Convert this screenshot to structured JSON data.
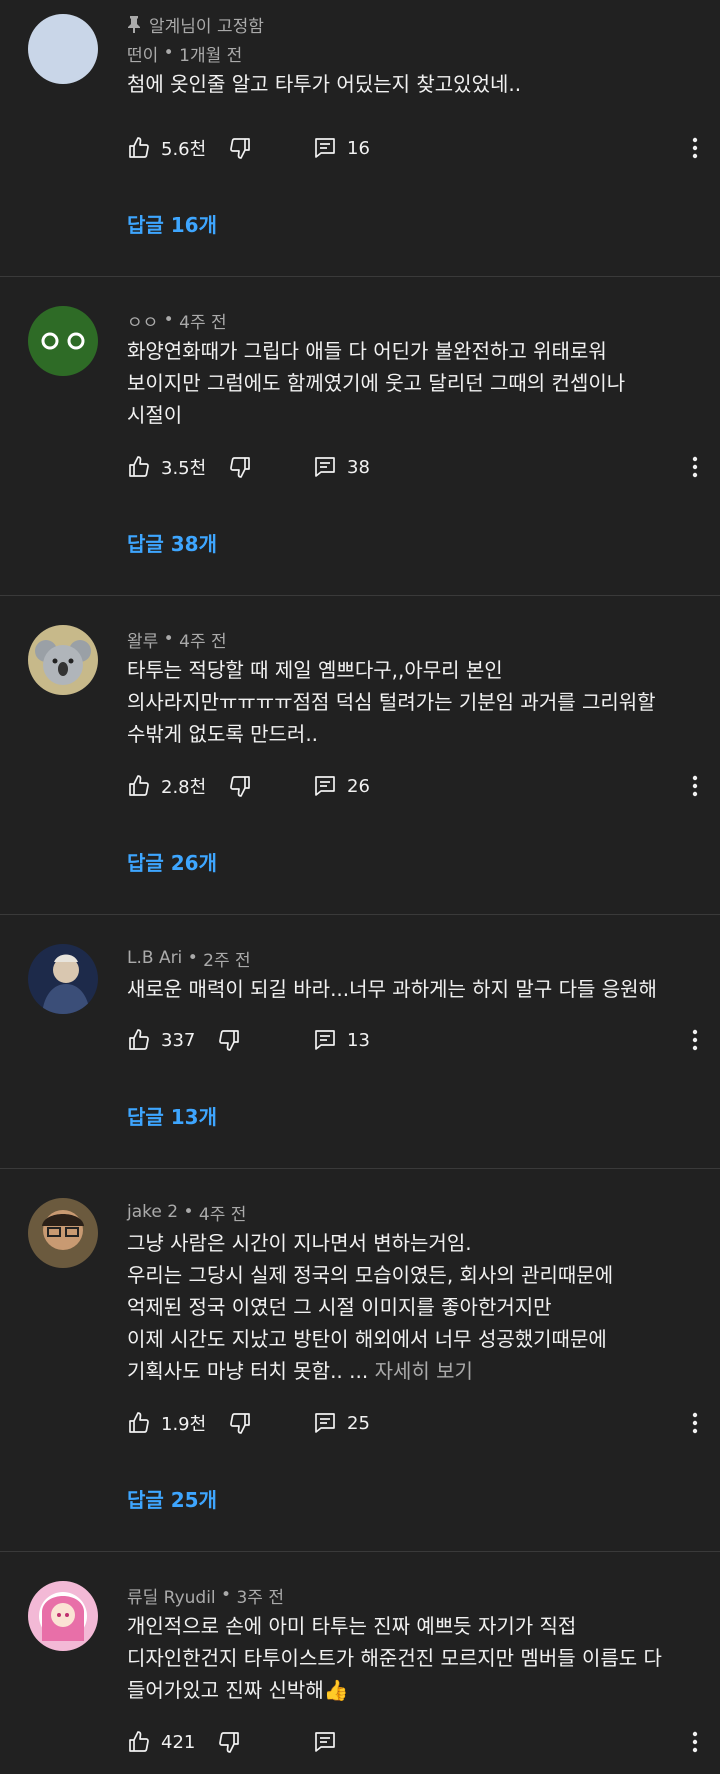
{
  "comments": [
    {
      "pinned_label": "알계님이 고정함",
      "author": "떤이",
      "time": "1개월 전",
      "lines": [
        "첨에 옷인줄 알고 타투가 어딨는지 찾고있었네.."
      ],
      "likes": "5.6천",
      "reply_count": "16",
      "replies_label": "답글 16개",
      "avatar_color": "#c9d6e8"
    },
    {
      "author": "ㅇㅇ",
      "time": "4주 전",
      "lines": [
        "화양연화때가 그립다 애들 다 어딘가 불완전하고 위태로워",
        "보이지만 그럼에도 함께였기에 웃고 달리던 그때의 컨셉이나",
        "시절이"
      ],
      "likes": "3.5천",
      "reply_count": "38",
      "replies_label": "답글 38개",
      "avatar_color": "#2e6b26"
    },
    {
      "author": "왈루",
      "time": "4주 전",
      "lines": [
        "타투는 적당할 때 제일 옘쁘다구,,아무리 본인",
        "의사라지만ㅠㅠㅠㅠ점점 덕심 털려가는 기분임 과거를 그리워할",
        "수밖게 없도록 만드러.."
      ],
      "likes": "2.8천",
      "reply_count": "26",
      "replies_label": "답글 26개",
      "avatar_color": "#c7b98a"
    },
    {
      "author": "L.B Ari",
      "time": "2주 전",
      "lines": [
        "새로운 매력이 되길 바라...너무 과하게는 하지 말구 다들 응원해"
      ],
      "likes": "337",
      "reply_count": "13",
      "replies_label": "답글 13개",
      "avatar_color": "#1d2a4a"
    },
    {
      "author": "jake 2",
      "time": "4주 전",
      "lines": [
        "그냥 사람은 시간이 지나면서 변하는거임.",
        "우리는 그당시 실제 정국의 모습이였든, 회사의 관리때문에",
        "억제된 정국 이였던 그 시절 이미지를 좋아한거지만",
        "이제 시간도 지났고 방탄이 해외에서 너무 성공했기때문에",
        "기획사도 마냥 터치 못함.. ..."
      ],
      "read_more": "자세히 보기",
      "likes": "1.9천",
      "reply_count": "25",
      "replies_label": "답글 25개",
      "avatar_color": "#6b5a3e"
    },
    {
      "author": "류딜 Ryudil",
      "time": "3주 전",
      "lines": [
        "개인적으로 손에 아미 타투는 진짜 예쁘듯 자기가 직접",
        "디자인한건지 타투이스트가 해준건진 모르지만 멤버들 이름도 다",
        "들어가있고 진짜 신박해👍"
      ],
      "likes": "421",
      "reply_count": "",
      "avatar_color": "#f3b9d6"
    }
  ]
}
